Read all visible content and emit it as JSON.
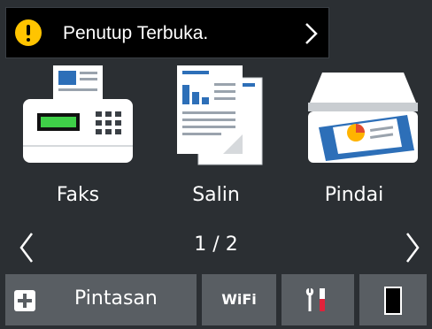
{
  "alert": {
    "icon": "warning-icon",
    "message": "Penutup Terbuka.",
    "colors": {
      "background": "#000000",
      "icon": "#ffc400"
    }
  },
  "apps": [
    {
      "label": "Faks",
      "icon": "fax-machine-icon"
    },
    {
      "label": "Salin",
      "icon": "copy-documents-icon"
    },
    {
      "label": "Pindai",
      "icon": "scanner-icon"
    }
  ],
  "pagination": {
    "text": "1 / 2",
    "current": 1,
    "total": 2
  },
  "bottom_bar": {
    "shortcut_label": "Pintasan",
    "wifi_label": "WiFi",
    "settings_icon": "settings-tools-icon",
    "ink_icon": "ink-toner-icon"
  },
  "colors": {
    "screen_bg": "#2b2f33",
    "bar_bg": "#595e63",
    "accent_blue": "#2d6fb8",
    "accent_red": "#e0223a"
  }
}
